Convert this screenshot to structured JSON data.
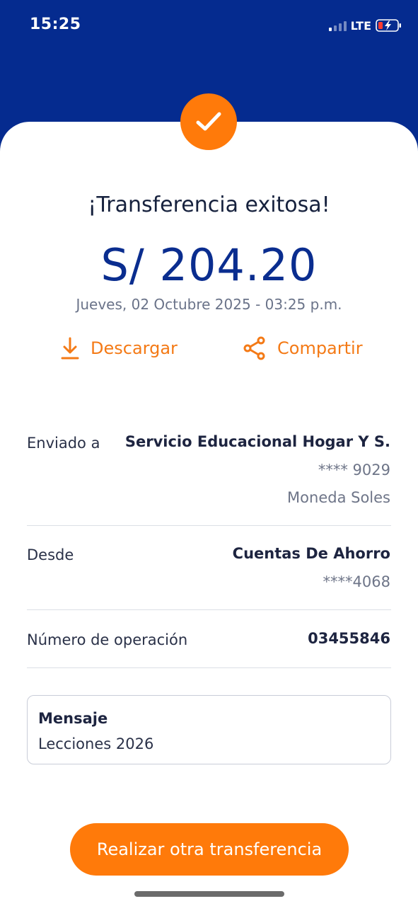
{
  "status_bar": {
    "time": "15:25",
    "network": "LTE",
    "signal_bars_filled": 1,
    "signal_bars_total": 4
  },
  "header": {
    "background_color": "#052b8f"
  },
  "success": {
    "icon": "check-icon",
    "title": "¡Transferencia exitosa!",
    "amount": "S/ 204.20",
    "datetime": "Jueves, 02 Octubre 2025 - 03:25 p.m."
  },
  "actions": {
    "download": {
      "label": "Descargar",
      "icon": "download-icon"
    },
    "share": {
      "label": "Compartir",
      "icon": "share-icon"
    }
  },
  "details": {
    "sent_to": {
      "label": "Enviado a",
      "name": "Servicio Educacional Hogar Y S.",
      "account": "**** 9029",
      "currency": "Moneda Soles"
    },
    "from": {
      "label": "Desde",
      "account_type": "Cuentas De Ahorro",
      "account": "****4068"
    },
    "operation": {
      "label": "Número de operación",
      "number": "03455846"
    }
  },
  "message": {
    "title": "Mensaje",
    "text": "Lecciones 2026"
  },
  "cta": {
    "label": "Realizar otra transferencia"
  },
  "colors": {
    "accent": "#ff7a0a",
    "brand": "#052b8f",
    "amount": "#0a2d8f"
  }
}
